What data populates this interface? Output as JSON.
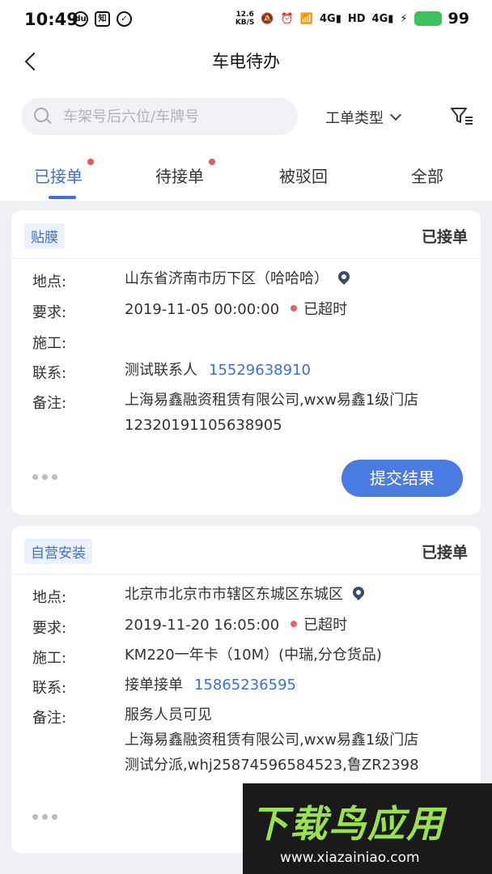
{
  "status_bar": {
    "time": "10:49",
    "left_icons": [
      "du-icon",
      "zhi-icon",
      "check-circle-icon"
    ],
    "net_speed": "12.6\nKB/S",
    "battery": "99"
  },
  "nav": {
    "title": "车电待办"
  },
  "search": {
    "placeholder": "车架号后六位/车牌号",
    "type_label": "工单类型"
  },
  "tabs": [
    {
      "label": "已接单",
      "active": true,
      "has_dot": true
    },
    {
      "label": "待接单",
      "active": false,
      "has_dot": true
    },
    {
      "label": "被驳回",
      "active": false,
      "has_dot": false
    },
    {
      "label": "全部",
      "active": false,
      "has_dot": false
    }
  ],
  "cards": [
    {
      "tag": "贴膜",
      "status": "已接单",
      "location_label": "地点:",
      "location": "山东省济南市历下区（哈哈哈）",
      "require_label": "要求:",
      "require_time": "2019-11-05 00:00:00",
      "overdue": "已超时",
      "construct_label": "施工:",
      "construct": "",
      "contact_label": "联系:",
      "contact_name": "测试联系人",
      "contact_phone": "15529638910",
      "remark_label": "备注:",
      "remark_lines": [
        "上海易鑫融资租赁有限公司,wxw易鑫1级门店",
        "12320191105638905"
      ],
      "submit": "提交结果"
    },
    {
      "tag": "自营安装",
      "status": "已接单",
      "location_label": "地点:",
      "location": "北京市北京市市辖区东城区东城区",
      "require_label": "要求:",
      "require_time": "2019-11-20 16:05:00",
      "overdue": "已超时",
      "construct_label": "施工:",
      "construct": "KM220一年卡（10M）(中瑞,分仓货品)",
      "contact_label": "联系:",
      "contact_name": "接单接单",
      "contact_phone": "15865236595",
      "remark_label": "备注:",
      "remark_lines": [
        "服务人员可见",
        "上海易鑫融资租赁有限公司,wxw易鑫1级门店",
        "测试分派,whj25874596584523,鲁ZR2398"
      ]
    }
  ],
  "watermark": {
    "main": "下载鸟应用",
    "url": "www.xiazainiao.com"
  }
}
